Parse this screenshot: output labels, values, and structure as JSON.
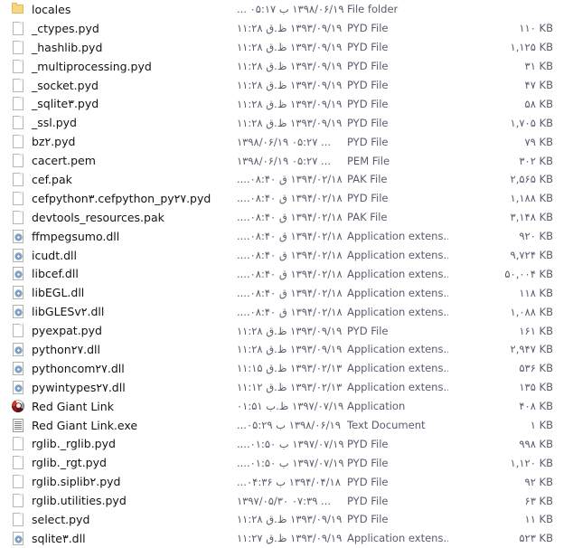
{
  "window": {
    "view": "details-list",
    "columns": [
      "Name",
      "Date modified",
      "Type",
      "Size"
    ]
  },
  "colors": {
    "background": "#ffffff",
    "name_text": "#131313",
    "meta_text": "#5a5a6e",
    "folder": "#f6d77f"
  },
  "rows": [
    {
      "icon": "folder-icon",
      "name": "locales",
      "date": "۱۳۹۸/۰۶/۱۹ ب ۰۵:۱۷ ...",
      "type": "File folder",
      "size": ""
    },
    {
      "icon": "page-icon",
      "name": "_ctypes.pyd",
      "date": "۱۳۹۳/۰۹/۱۹ ظ.ق ۱۱:۲۸",
      "type": "PYD File",
      "size": "۱۱۰ KB"
    },
    {
      "icon": "page-icon",
      "name": "_hashlib.pyd",
      "date": "۱۳۹۳/۰۹/۱۹ ظ.ق ۱۱:۲۸",
      "type": "PYD File",
      "size": "۱,۱۲۵ KB"
    },
    {
      "icon": "page-icon",
      "name": "_multiprocessing.pyd",
      "date": "۱۳۹۳/۰۹/۱۹ ظ.ق ۱۱:۲۸",
      "type": "PYD File",
      "size": "۳۱ KB"
    },
    {
      "icon": "page-icon",
      "name": "_socket.pyd",
      "date": "۱۳۹۳/۰۹/۱۹ ظ.ق ۱۱:۲۸",
      "type": "PYD File",
      "size": "۴۷ KB"
    },
    {
      "icon": "page-icon",
      "name": "_sqlite۳.pyd",
      "date": "۱۳۹۳/۰۹/۱۹ ظ.ق ۱۱:۲۸",
      "type": "PYD File",
      "size": "۵۸ KB"
    },
    {
      "icon": "page-icon",
      "name": "_ssl.pyd",
      "date": "۱۳۹۳/۰۹/۱۹ ظ.ق ۱۱:۲۸",
      "type": "PYD File",
      "size": "۱,۷۰۵ KB"
    },
    {
      "icon": "page-icon",
      "name": "bz۲.pyd",
      "date": "۱۳۹۸/۰۶/۱۹ ۰۵:۲۷ ...",
      "type": "PYD File",
      "size": "۷۹ KB"
    },
    {
      "icon": "page-icon",
      "name": "cacert.pem",
      "date": "۱۳۹۸/۰۶/۱۹ ۰۵:۲۷ ...",
      "type": "PEM File",
      "size": "۳۰۲ KB"
    },
    {
      "icon": "page-icon",
      "name": "cef.pak",
      "date": "۱۳۹۴/۰۲/۱۸ ق ۰۸:۴۰....",
      "type": "PAK File",
      "size": "۲,۵۶۵ KB"
    },
    {
      "icon": "page-icon",
      "name": "cefpython۳.cefpython_py۲۷.pyd",
      "date": "۱۳۹۴/۰۲/۱۸ ق ۰۸:۴۰....",
      "type": "PYD File",
      "size": "۱,۱۸۸ KB"
    },
    {
      "icon": "page-icon",
      "name": "devtools_resources.pak",
      "date": "۱۳۹۴/۰۲/۱۸ ق ۰۸:۴۰....",
      "type": "PAK File",
      "size": "۳,۱۴۸ KB"
    },
    {
      "icon": "dll-icon",
      "name": "ffmpegsumo.dll",
      "date": "۱۳۹۴/۰۲/۱۸ ق ۰۸:۴۰....",
      "type": "Application extens...",
      "size": "۹۲۰ KB"
    },
    {
      "icon": "dll-icon",
      "name": "icudt.dll",
      "date": "۱۳۹۴/۰۲/۱۸ ق ۰۸:۴۰....",
      "type": "Application extens...",
      "size": "۹,۷۲۴ KB"
    },
    {
      "icon": "dll-icon",
      "name": "libcef.dll",
      "date": "۱۳۹۴/۰۲/۱۸ ق ۰۸:۴۰....",
      "type": "Application extens...",
      "size": "۵۰,۰۰۴ KB"
    },
    {
      "icon": "dll-icon",
      "name": "libEGL.dll",
      "date": "۱۳۹۴/۰۲/۱۸ ق ۰۸:۴۰....",
      "type": "Application extens...",
      "size": "۱۱۸ KB"
    },
    {
      "icon": "dll-icon",
      "name": "libGLESv۲.dll",
      "date": "۱۳۹۴/۰۲/۱۸ ق ۰۸:۴۰....",
      "type": "Application extens...",
      "size": "۱,۰۸۸ KB"
    },
    {
      "icon": "page-icon",
      "name": "pyexpat.pyd",
      "date": "۱۳۹۳/۰۹/۱۹ ظ.ق ۱۱:۲۸",
      "type": "PYD File",
      "size": "۱۶۱ KB"
    },
    {
      "icon": "dll-icon",
      "name": "python۲۷.dll",
      "date": "۱۳۹۳/۰۹/۱۹ ظ.ق ۱۱:۲۸",
      "type": "Application extens...",
      "size": "۲,۹۴۷ KB"
    },
    {
      "icon": "dll-icon",
      "name": "pythoncom۲۷.dll",
      "date": "۱۳۹۳/۰۲/۱۳ ظ.ق ۱۱:۱۵",
      "type": "Application extens...",
      "size": "۵۳۶ KB"
    },
    {
      "icon": "dll-icon",
      "name": "pywintypes۲۷.dll",
      "date": "۱۳۹۳/۰۲/۱۳ ظ.ق ۱۱:۱۲",
      "type": "Application extens...",
      "size": "۱۳۵ KB"
    },
    {
      "icon": "application-icon",
      "name": "Red Giant Link",
      "date": "۱۳۹۷/۰۷/۱۹ ظ.ب ۰۱:۵۱",
      "type": "Application",
      "size": "۴۰۸ KB"
    },
    {
      "icon": "text-document-icon",
      "name": "Red Giant Link.exe",
      "date": "۱۳۹۸/۰۶/۱۹ ب ۰۵:۲۹...",
      "type": "Text Document",
      "size": "۱ KB"
    },
    {
      "icon": "page-icon",
      "name": "rglib._rglib.pyd",
      "date": "۱۳۹۷/۰۷/۱۹ ب ۰۱:۵۰....",
      "type": "PYD File",
      "size": "۹۹۸ KB"
    },
    {
      "icon": "page-icon",
      "name": "rglib._rgt.pyd",
      "date": "۱۳۹۷/۰۷/۱۹ ب ۰۱:۵۰....",
      "type": "PYD File",
      "size": "۱,۱۲۰ KB"
    },
    {
      "icon": "page-icon",
      "name": "rglib.siplib۲.pyd",
      "date": "۱۳۹۴/۰۴/۱۸ ب ۰۴:۳۶...",
      "type": "PYD File",
      "size": "۹۲ KB"
    },
    {
      "icon": "page-icon",
      "name": "rglib.utilities.pyd",
      "date": "۱۳۹۷/۰۵/۳۰ ۰۷:۳۹ ...",
      "type": "PYD File",
      "size": "۶۳ KB"
    },
    {
      "icon": "page-icon",
      "name": "select.pyd",
      "date": "۱۳۹۳/۰۹/۱۹ ظ.ق ۱۱:۲۸",
      "type": "PYD File",
      "size": "۱۱ KB"
    },
    {
      "icon": "dll-icon",
      "name": "sqlite۳.dll",
      "date": "۱۳۹۳/۰۹/۱۹ ظ.ق ۱۱:۲۷",
      "type": "Application extens...",
      "size": "۵۲۳ KB"
    }
  ]
}
